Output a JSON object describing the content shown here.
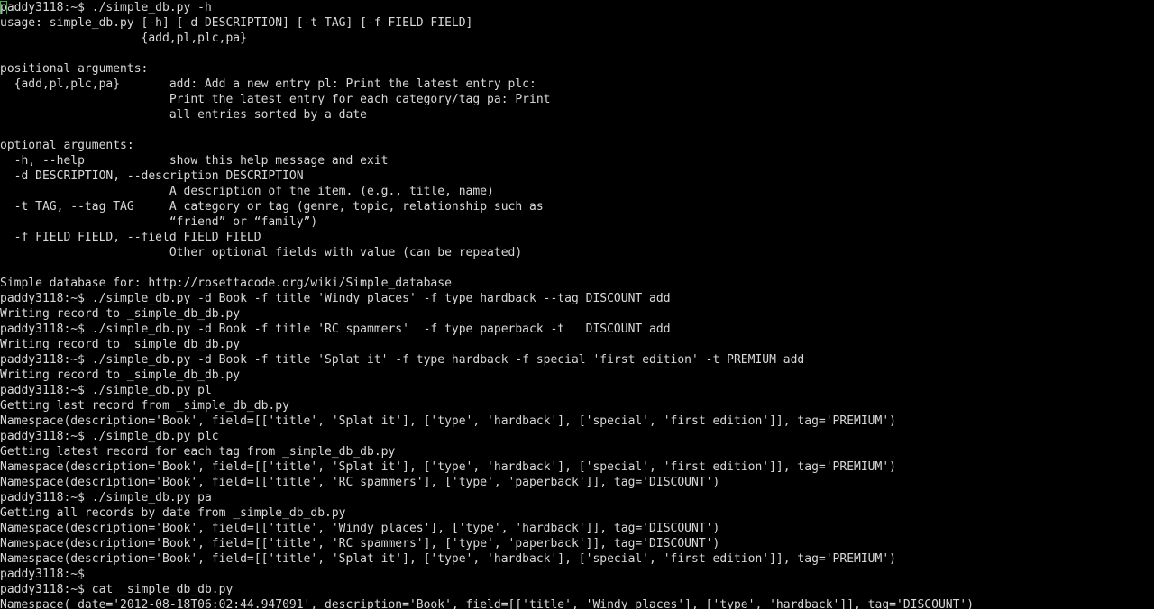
{
  "terminal": {
    "title": "paddy3118 terminal",
    "prompt": "paddy3118:~$",
    "colors": {
      "background": "#000000",
      "foreground": "#d8d8d8",
      "cursor_outline": "#3cb043"
    },
    "cursor": {
      "shape": "hollow-block",
      "row": 0,
      "col": 0,
      "char": "p"
    },
    "cols": 158,
    "rows": 40,
    "font_size_px": 13,
    "line_height_px": 17
  },
  "commands": [
    {
      "prompt": "paddy3118:~$",
      "text": "./simple_db.py -h"
    },
    {
      "prompt": "paddy3118:~$",
      "text": "./simple_db.py -d Book -f title 'Windy places' -f type hardback --tag DISCOUNT add"
    },
    {
      "prompt": "paddy3118:~$",
      "text": "./simple_db.py -d Book -f title 'RC spammers'  -f type paperback -t   DISCOUNT add"
    },
    {
      "prompt": "paddy3118:~$",
      "text": "./simple_db.py -d Book -f title 'Splat it' -f type hardback -f special 'first edition' -t PREMIUM add"
    },
    {
      "prompt": "paddy3118:~$",
      "text": "./simple_db.py pl"
    },
    {
      "prompt": "paddy3118:~$",
      "text": "./simple_db.py plc"
    },
    {
      "prompt": "paddy3118:~$",
      "text": "./simple_db.py pa"
    },
    {
      "prompt": "paddy3118:~$",
      "text": ""
    },
    {
      "prompt": "paddy3118:~$",
      "text": "cat _simple_db_db.py"
    }
  ],
  "lines": [
    "paddy3118:~$ ./simple_db.py -h",
    "usage: simple_db.py [-h] [-d DESCRIPTION] [-t TAG] [-f FIELD FIELD]",
    "                    {add,pl,plc,pa}",
    "",
    "positional arguments:",
    "  {add,pl,plc,pa}       add: Add a new entry pl: Print the latest entry plc:",
    "                        Print the latest entry for each category/tag pa: Print",
    "                        all entries sorted by a date",
    "",
    "optional arguments:",
    "  -h, --help            show this help message and exit",
    "  -d DESCRIPTION, --description DESCRIPTION",
    "                        A description of the item. (e.g., title, name)",
    "  -t TAG, --tag TAG     A category or tag (genre, topic, relationship such as",
    "                        “friend” or “family”)",
    "  -f FIELD FIELD, --field FIELD FIELD",
    "                        Other optional fields with value (can be repeated)",
    "",
    "Simple database for: http://rosettacode.org/wiki/Simple_database",
    "paddy3118:~$ ./simple_db.py -d Book -f title 'Windy places' -f type hardback --tag DISCOUNT add",
    "Writing record to _simple_db_db.py",
    "paddy3118:~$ ./simple_db.py -d Book -f title 'RC spammers'  -f type paperback -t   DISCOUNT add",
    "Writing record to _simple_db_db.py",
    "paddy3118:~$ ./simple_db.py -d Book -f title 'Splat it' -f type hardback -f special 'first edition' -t PREMIUM add",
    "Writing record to _simple_db_db.py",
    "paddy3118:~$ ./simple_db.py pl",
    "Getting last record from _simple_db_db.py",
    "Namespace(description='Book', field=[['title', 'Splat it'], ['type', 'hardback'], ['special', 'first edition']], tag='PREMIUM')",
    "paddy3118:~$ ./simple_db.py plc",
    "Getting latest record for each tag from _simple_db_db.py",
    "Namespace(description='Book', field=[['title', 'Splat it'], ['type', 'hardback'], ['special', 'first edition']], tag='PREMIUM')",
    "Namespace(description='Book', field=[['title', 'RC spammers'], ['type', 'paperback']], tag='DISCOUNT')",
    "paddy3118:~$ ./simple_db.py pa",
    "Getting all records by date from _simple_db_db.py",
    "Namespace(description='Book', field=[['title', 'Windy places'], ['type', 'hardback']], tag='DISCOUNT')",
    "Namespace(description='Book', field=[['title', 'RC spammers'], ['type', 'paperback']], tag='DISCOUNT')",
    "Namespace(description='Book', field=[['title', 'Splat it'], ['type', 'hardback'], ['special', 'first edition']], tag='PREMIUM')",
    "paddy3118:~$ ",
    "paddy3118:~$ cat _simple_db_db.py",
    "Namespace( date='2012-08-18T06:02:44.947091', description='Book', field=[['title', 'Windy places'], ['type', 'hardback']], tag='DISCOUNT')"
  ],
  "help_output": {
    "usage": "usage: simple_db.py [-h] [-d DESCRIPTION] [-t TAG] [-f FIELD FIELD]",
    "usage_choices": "{add,pl,plc,pa}",
    "positional_heading": "positional arguments:",
    "positional": [
      {
        "name": "{add,pl,plc,pa}",
        "description": "add: Add a new entry pl: Print the latest entry plc: Print the latest entry for each category/tag pa: Print all entries sorted by a date"
      }
    ],
    "optional_heading": "optional arguments:",
    "optionals": [
      {
        "name": "-h, --help",
        "description": "show this help message and exit"
      },
      {
        "name": "-d DESCRIPTION, --description DESCRIPTION",
        "description": "A description of the item. (e.g., title, name)"
      },
      {
        "name": "-t TAG, --tag TAG",
        "description": "A category or tag (genre, topic, relationship such as “friend” or “family”)"
      },
      {
        "name": "-f FIELD FIELD, --field FIELD FIELD",
        "description": "Other optional fields with value (can be repeated)"
      }
    ],
    "epilog": "Simple database for: http://rosettacode.org/wiki/Simple_database"
  },
  "status_messages": {
    "writing_record": "Writing record to _simple_db_db.py",
    "getting_last": "Getting last record from _simple_db_db.py",
    "getting_latest_each_tag": "Getting latest record for each tag from _simple_db_db.py",
    "getting_all_by_date": "Getting all records by date from _simple_db_db.py"
  },
  "records": [
    {
      "description": "Book",
      "fields": [
        [
          "title",
          "Windy places"
        ],
        [
          "type",
          "hardback"
        ]
      ],
      "tag": "DISCOUNT",
      "date": "2012-08-18T06:02:44.947091"
    },
    {
      "description": "Book",
      "fields": [
        [
          "title",
          "RC spammers"
        ],
        [
          "type",
          "paperback"
        ]
      ],
      "tag": "DISCOUNT"
    },
    {
      "description": "Book",
      "fields": [
        [
          "title",
          "Splat it"
        ],
        [
          "type",
          "hardback"
        ],
        [
          "special",
          "first edition"
        ]
      ],
      "tag": "PREMIUM"
    }
  ]
}
